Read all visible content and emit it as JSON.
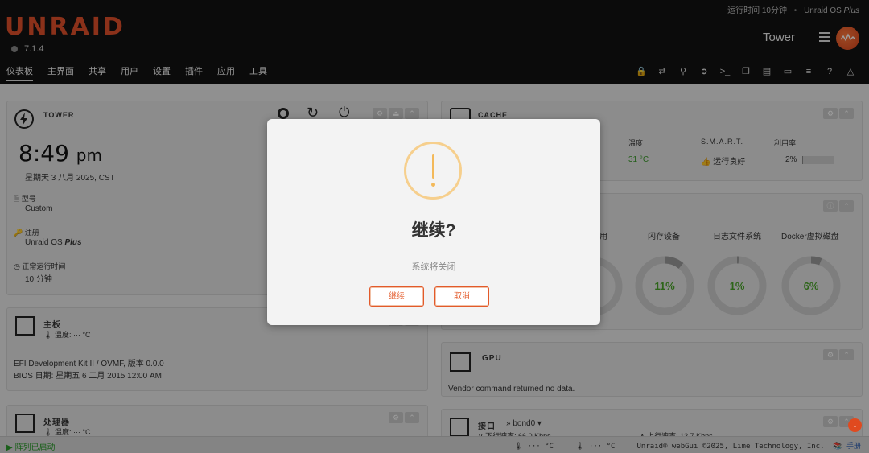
{
  "header": {
    "uptime_label": "运行时间 10分钟",
    "os_name": "Unraid OS",
    "os_edition": "Plus",
    "logo_text": "UNRAID",
    "version": "7.1.4",
    "server_name": "Tower"
  },
  "nav": {
    "tabs": [
      "仪表板",
      "主界面",
      "共享",
      "用户",
      "设置",
      "插件",
      "应用",
      "工具"
    ],
    "active": "仪表板"
  },
  "tower_panel": {
    "title": "TOWER",
    "time": "8:49",
    "ampm": "pm",
    "date": "星期天 3 八月 2025, CST",
    "model_label": "型号",
    "model_value": "Custom",
    "reg_label": "注册",
    "reg_value": "Unraid OS",
    "reg_edition": "Plus",
    "uptime_label": "正常运行时间",
    "uptime_value": "10 分钟"
  },
  "mobo_panel": {
    "title": "主板",
    "temp": "温度: ··· °C",
    "line1": "EFI Development Kit II / OVMF, 版本 0.0.0",
    "line2": "BIOS 日期: 星期五 6 二月 2015 12:00 AM"
  },
  "cpu_panel": {
    "title": "处理器",
    "temp": "温度: ··· °C"
  },
  "cache_panel": {
    "title": "CACHE",
    "col_temp": "温度",
    "col_smart": "S.M.A.R.T.",
    "col_util": "利用率",
    "temp_value": "31 °C",
    "smart_value": "运行良好",
    "util_value": "2%",
    "util_fraction": 0.02
  },
  "usage_panel": {
    "partial_label": "用",
    "items": [
      {
        "label": "闪存设备",
        "value": "11%",
        "fraction": 0.11
      },
      {
        "label": "日志文件系统",
        "value": "1%",
        "fraction": 0.01
      },
      {
        "label": "Docker虚拟磁盘",
        "value": "6%",
        "fraction": 0.06
      }
    ]
  },
  "gpu_panel": {
    "title": "GPU",
    "message": "Vendor command returned no data."
  },
  "iface_panel": {
    "title": "接口",
    "interface": "bond0",
    "down_rate": "下行速率: 66.0 Kbps",
    "up_rate": "上行速率: 13.7 Kbps"
  },
  "modal": {
    "title": "继续?",
    "message": "系统将关闭",
    "confirm_label": "继续",
    "cancel_label": "取消"
  },
  "statusbar": {
    "array_status": "阵列已启动",
    "temp1": "··· °C",
    "temp2": "··· °C",
    "copyright": "Unraid® webGui ©2025, Lime Technology, Inc.",
    "manual_label": "手册"
  },
  "colors": {
    "brand": "#e0502a",
    "accent_green": "#3fbf3f",
    "warning": "#f3b95a",
    "donut_green": "#4aa329"
  }
}
